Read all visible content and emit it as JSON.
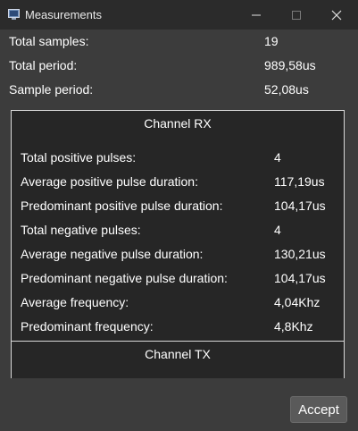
{
  "window": {
    "title": "Measurements"
  },
  "summary": [
    {
      "label": "Total samples:",
      "value": "19"
    },
    {
      "label": "Total period:",
      "value": "989,58us"
    },
    {
      "label": "Sample period:",
      "value": "52,08us"
    }
  ],
  "channels": [
    {
      "title": "Channel RX",
      "metrics": [
        {
          "label": "Total positive pulses:",
          "value": "4"
        },
        {
          "label": "Average positive pulse duration:",
          "value": "117,19us"
        },
        {
          "label": "Predominant positive pulse duration:",
          "value": "104,17us"
        },
        {
          "label": "Total negative pulses:",
          "value": "4"
        },
        {
          "label": "Average negative pulse duration:",
          "value": "130,21us"
        },
        {
          "label": "Predominant negative pulse duration:",
          "value": "104,17us"
        },
        {
          "label": "Average frequency:",
          "value": "4,04Khz"
        },
        {
          "label": "Predominant frequency:",
          "value": "4,8Khz"
        }
      ]
    },
    {
      "title": "Channel TX"
    }
  ],
  "buttons": {
    "accept": "Accept"
  },
  "icons": {
    "app": "window-app-icon",
    "minimize": "minimize-icon",
    "maximize": "maximize-icon",
    "close": "close-icon"
  }
}
